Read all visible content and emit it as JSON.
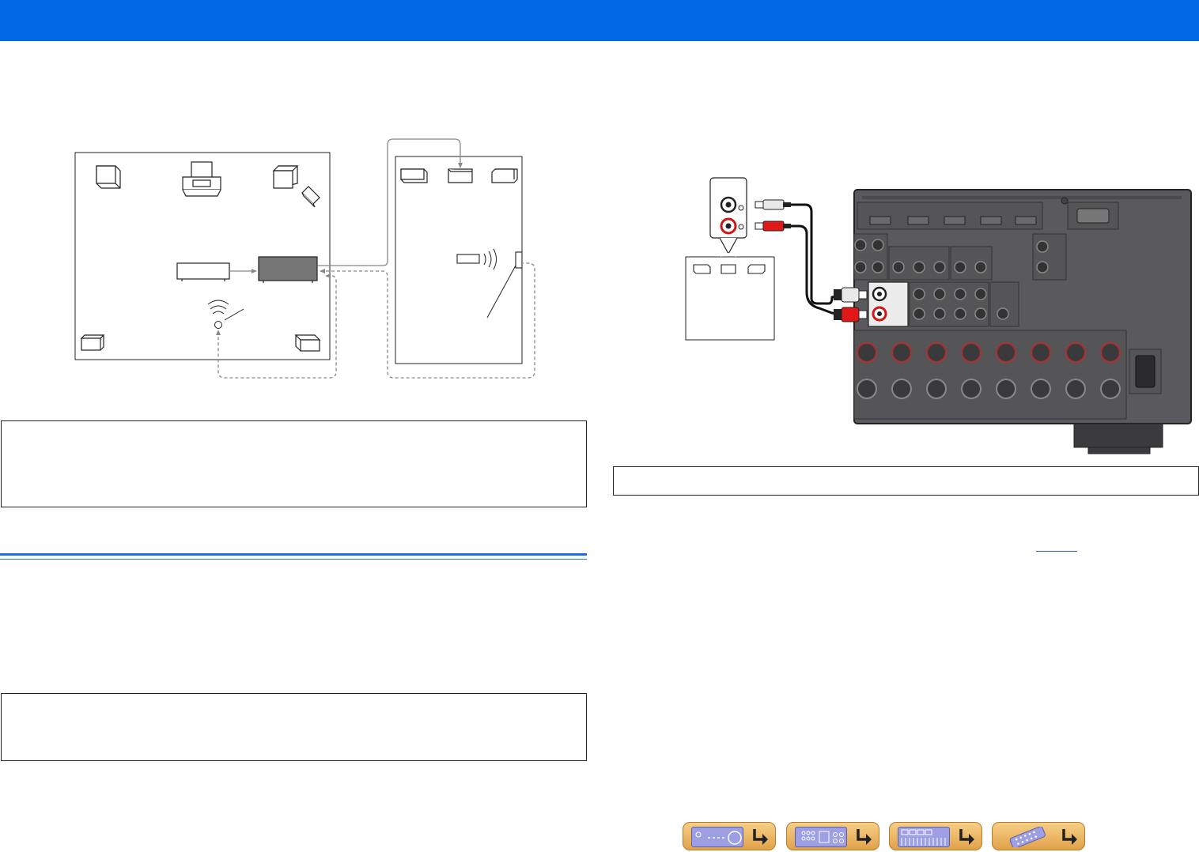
{
  "header": {
    "title": ""
  },
  "diagram_left": {
    "cable_style": "dashed",
    "signal_arrow": "solid"
  },
  "diagram_right": {
    "cable_colors": {
      "white": "#e9e9e9",
      "red": "#e01818"
    },
    "panel_color": "#5a5a5e"
  },
  "colors": {
    "header_blue": "#0068e3",
    "section_rule": "#1f6fe0",
    "nav_button": "#e9b25f",
    "nav_thumb": "#9d9fe2"
  },
  "nav": {
    "buttons": [
      {
        "icon": "front-panel-icon"
      },
      {
        "icon": "rear-panel-icon"
      },
      {
        "icon": "setup-menu-icon"
      },
      {
        "icon": "remote-control-icon"
      }
    ]
  }
}
